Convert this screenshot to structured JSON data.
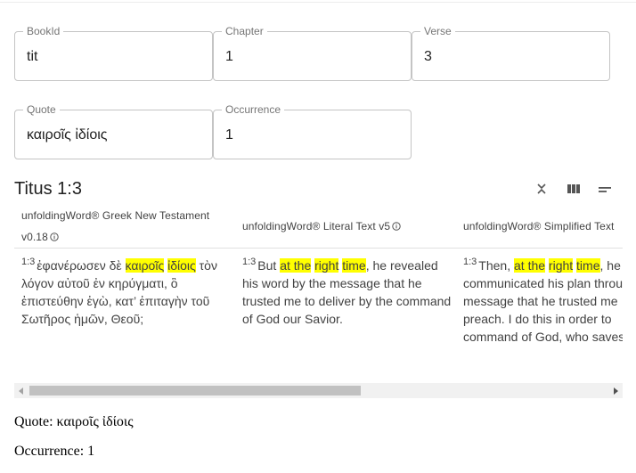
{
  "fields": {
    "bookid": {
      "label": "BookId",
      "value": "tit"
    },
    "chapter": {
      "label": "Chapter",
      "value": "1"
    },
    "verse": {
      "label": "Verse",
      "value": "3"
    },
    "quote": {
      "label": "Quote",
      "value": "καιροῖς ἰδίοις"
    },
    "occurrence": {
      "label": "Occurrence",
      "value": "1"
    }
  },
  "reference_title": "Titus 1:3",
  "toolbar": {
    "icons": [
      "collapse-icon",
      "columns-icon",
      "text-align-icon"
    ]
  },
  "columns": [
    {
      "header_line1": "unfoldingWord® Greek New Testament",
      "header_line2": "v0.18",
      "verse_num": "1:3",
      "lines": [
        [
          {
            "t": "ἐφανέρωσεν δὲ "
          },
          {
            "t": "καιροῖς",
            "h": true
          },
          {
            "t": " "
          },
          {
            "t": "ἰδίοις",
            "h": true
          },
          {
            "t": " τὸν"
          }
        ],
        [
          {
            "t": "λόγον αὐτοῦ ἐν κηρύγματι, ὃ"
          }
        ],
        [
          {
            "t": "ἐπιστεύθην ἐγὼ, κατ’ ἐπιταγὴν τοῦ"
          }
        ],
        [
          {
            "t": "Σωτῆρος ἡμῶν, Θεοῦ;"
          }
        ]
      ]
    },
    {
      "header_line1": "unfoldingWord® Literal Text v5",
      "header_line2": "",
      "verse_num": "1:3",
      "lines": [
        [
          {
            "t": "But "
          },
          {
            "t": "at the",
            "h": true
          },
          {
            "t": " "
          },
          {
            "t": "right",
            "h": true
          },
          {
            "t": " "
          },
          {
            "t": "time",
            "h": true
          },
          {
            "t": ", he revealed"
          }
        ],
        [
          {
            "t": "his word by the message that he"
          }
        ],
        [
          {
            "t": "trusted me to deliver by the command"
          }
        ],
        [
          {
            "t": "of God our Savior."
          }
        ]
      ]
    },
    {
      "header_line1": "unfoldingWord® Simplified Text",
      "header_line2": "",
      "verse_num": "1:3",
      "lines": [
        [
          {
            "t": "Then, "
          },
          {
            "t": "at the",
            "h": true
          },
          {
            "t": " "
          },
          {
            "t": "right",
            "h": true
          },
          {
            "t": " "
          },
          {
            "t": "time",
            "h": true
          },
          {
            "t": ", he"
          }
        ],
        [
          {
            "t": "communicated his plan through"
          }
        ],
        [
          {
            "t": "message that he trusted me"
          }
        ],
        [
          {
            "t": "preach. I do this in order to"
          }
        ],
        [
          {
            "t": "command of God, who saves"
          }
        ]
      ]
    }
  ],
  "output": {
    "quote_line": "Quote: καιροῖς ἰδίοις",
    "occurrence_line": "Occurrence: 1"
  },
  "colors": {
    "highlight": "#ffff00",
    "border": "#c4c4c4",
    "label": "#757575"
  }
}
